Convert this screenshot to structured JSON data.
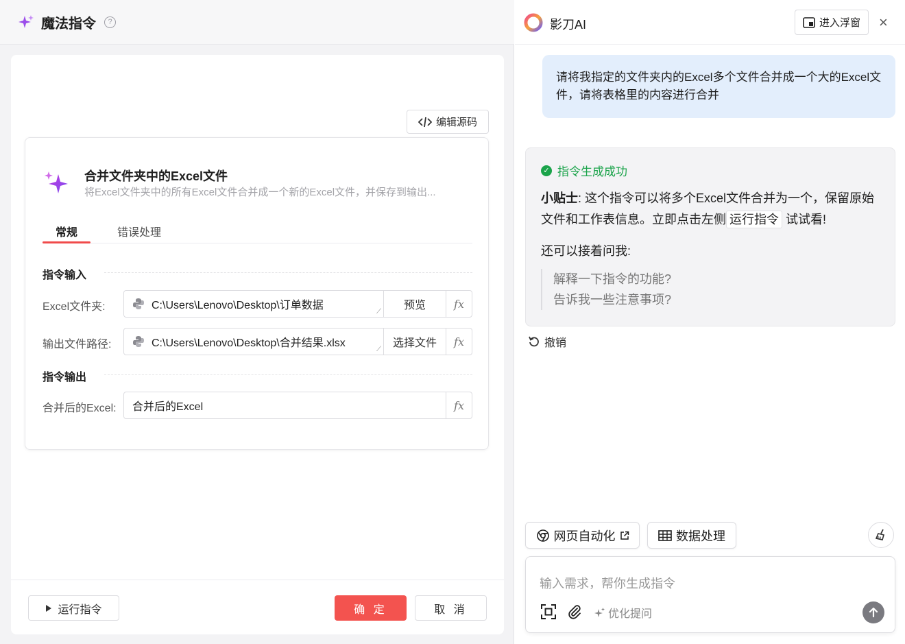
{
  "left": {
    "title": "魔法指令",
    "help": "?",
    "edit_source_label": "编辑源码",
    "command": {
      "title": "合并文件夹中的Excel文件",
      "description": "将Excel文件夹中的所有Excel文件合并成一个新的Excel文件，并保存到输出..."
    },
    "tabs": [
      {
        "label": "常规",
        "active": true
      },
      {
        "label": "错误处理",
        "active": false
      }
    ],
    "input_section": "指令输入",
    "output_section": "指令输出",
    "fields": [
      {
        "label": "Excel文件夹:",
        "value": "C:\\Users\\Lenovo\\Desktop\\订单数据",
        "button": "预览"
      },
      {
        "label": "输出文件路径:",
        "value": "C:\\Users\\Lenovo\\Desktop\\合并结果.xlsx",
        "button": "选择文件"
      }
    ],
    "output_field": {
      "label": "合并后的Excel:",
      "value": "合并后的Excel"
    },
    "fx": "fx",
    "run_label": "运行指令",
    "ok_label": "确 定",
    "cancel_label": "取 消",
    "accent_color": "#f3534f"
  },
  "right": {
    "app_name": "影刀AI",
    "float_label": "进入浮窗",
    "close": "×",
    "user_message": "请将我指定的文件夹内的Excel多个文件合并成一个大的Excel文件，请将表格里的内容进行合并",
    "ai": {
      "status": "指令生成成功",
      "status_color": "#1aa34a",
      "tip_bold": "小贴士",
      "tip_text": ": 这个指令可以将多个Excel文件合并为一个，保留原始文件和工作表信息。立即点击左侧",
      "tip_code": "运行指令",
      "tip_end": "试试看!",
      "more": "还可以接着问我:",
      "suggestions": [
        "解释一下指令的功能?",
        "告诉我一些注意事项?"
      ]
    },
    "undo_label": "撤销",
    "chips": [
      {
        "label": "网页自动化",
        "icon": "chrome-icon"
      },
      {
        "label": "数据处理",
        "icon": "table-icon"
      }
    ],
    "input_placeholder": "输入需求，帮你生成指令",
    "optimize_label": "优化提问"
  }
}
